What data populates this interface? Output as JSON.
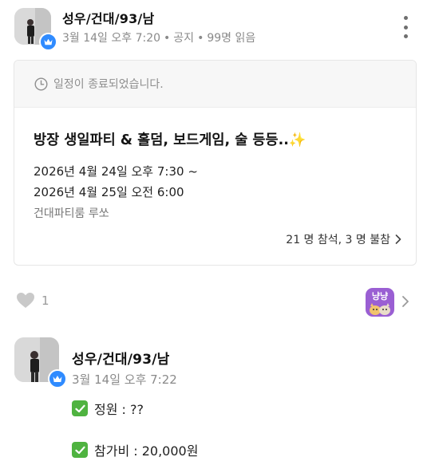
{
  "post": {
    "author": "성우/건대/93/남",
    "date": "3월 14일 오후 7:20",
    "category": "공지",
    "views": "99명 읽음",
    "badge_icon": "crown-icon",
    "more_icon": "more-vertical-icon"
  },
  "schedule": {
    "status": "일정이 종료되었습니다.",
    "status_icon": "clock-icon",
    "title": "방장 생일파티 & 홀덤, 보드게임, 술 등등..✨",
    "start": "2026년 4월 24일 오후 7:30 ~",
    "end": "2026년 4월 25일 오전 6:00",
    "place": "건대파티룸 루쏘",
    "attendance": "21 명 참석, 3 명 불참",
    "accent": "#2f8bff"
  },
  "reactions": {
    "like_count": "1",
    "like_icon": "heart-icon",
    "reactor_label": "냥냥"
  },
  "comment": {
    "author": "성우/건대/93/남",
    "date": "3월 14일 오후 7:22",
    "lines": [
      "정원 : ??",
      "참가비 : 20,000원"
    ],
    "check_color": "#4fb340"
  }
}
